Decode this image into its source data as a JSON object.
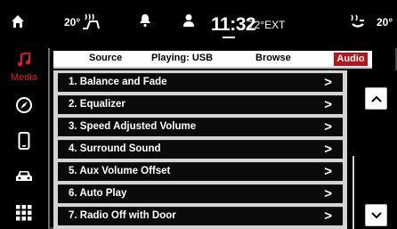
{
  "status_bar": {
    "left_temp": "20°",
    "right_temp": "20°",
    "clock": "11:32",
    "outside_temp": "72°EXT"
  },
  "sidebar": {
    "media_label": "Media"
  },
  "tabs": {
    "source": "Source",
    "playing": "Playing: USB",
    "browse": "Browse",
    "audio": "Audio"
  },
  "list": {
    "items": [
      {
        "label": "1. Balance and Fade",
        "chevron": ">"
      },
      {
        "label": "2. Equalizer",
        "chevron": ">"
      },
      {
        "label": "3. Speed Adjusted Volume",
        "chevron": ">"
      },
      {
        "label": "4. Surround Sound",
        "chevron": ">"
      },
      {
        "label": "5. Aux Volume Offset",
        "chevron": ">"
      },
      {
        "label": "6. Auto Play",
        "chevron": ">"
      },
      {
        "label": "7. Radio Off with Door",
        "chevron": ">"
      }
    ]
  },
  "colors": {
    "accent_red": "#e31b23",
    "active_tab_bg": "#b7141c"
  }
}
